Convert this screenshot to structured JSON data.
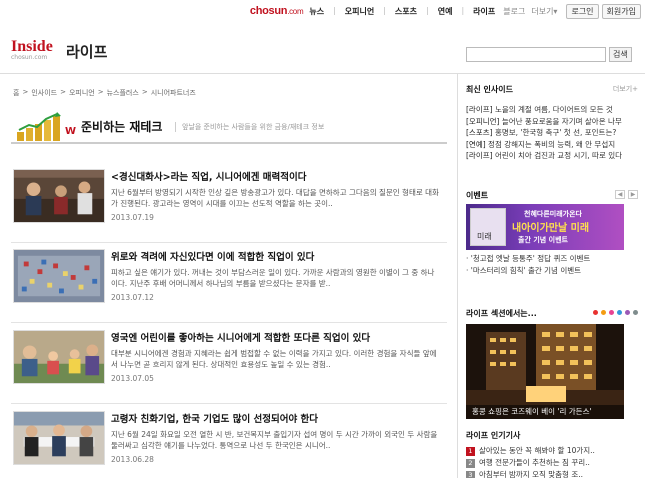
{
  "gnb": {
    "logo": "chosun",
    "logo_suffix": ".com",
    "nav": [
      "뉴스",
      "오피니언",
      "스포츠",
      "연예",
      "라이프"
    ],
    "sub": [
      "블로그",
      "더보기▾"
    ],
    "login": "로그인",
    "join": "회원가입"
  },
  "header": {
    "brand_name": "Inside",
    "brand_site": "chosun.com",
    "section": "라이프",
    "search_placeholder": "",
    "search_button": "검색"
  },
  "breadcrumb": [
    "홈",
    "인사이드",
    "오피니언",
    "뉴스플러스",
    "시니어파트너즈"
  ],
  "banner": {
    "title": "준비하는 재테크",
    "desc": "앞날을 준비하는 사람들을 위한 금융/재테크 정보"
  },
  "articles": [
    {
      "title": "<경신대화사>라는 직업, 시니어에겐 매력적이다",
      "summary": "지난 6월부터 방영되기 시작한 인상 깊은 방송광고가 있다. 대답을 면하하고 그다음의 질문인 형태로 대화가 진행된다. 광고라는 영역이 시대를 이끄는 선도적 역할을 하는 곳이..",
      "date": "2013.07.19"
    },
    {
      "title": "위로와 격려에 자신있다면 이에 적합한 직업이 있다",
      "summary": "피하고 싶은 얘기가 있다. 꺼내는 것이 부담스러운 일이 있다. 가까운 사람과의 영원한 이별이 그 중 하나이다. 지난주 후배 어머니께서 하나님의 부름을 받으셨다는 문자를 받..",
      "date": "2013.07.12"
    },
    {
      "title": "영국엔 어린이를 좋아하는 시니어에게 적합한 또다른 직업이 있다",
      "summary": "대부분 시니어에겐 경험과 지혜라는 쉽게 범접할 수 없는 이력을 가지고 있다. 이러한 경험을 자식들 앞에서 나누면 곧 흐리지 않게 된다. 상대적인 효용성도 높일 수 있는 경험..",
      "date": "2013.07.05"
    },
    {
      "title": "고령자 친화기업, 한국 기업도 많이 선정되어야 한다",
      "summary": "지난 6월 24일 화요일 오전 열한 시 반, 보건복지부 출입기자 섭여 명이 두 시간 가까이 외국인 두 사람을 둘러싸고 심각한 얘기를 나누었다. 통역으로 나선 두 한국인은 시니어..",
      "date": "2013.06.28"
    }
  ],
  "sidebar": {
    "latest_title": "최신 인사이드",
    "latest_more": "더보기+",
    "latest": [
      {
        "tag": "[라이프]",
        "text": " 노을의 계절 여름, 다이어트의 모든 것"
      },
      {
        "tag": "[오피니언]",
        "text": " 늘어난 풍요로움을 자기며 살아온 나무"
      },
      {
        "tag": "[스포츠]",
        "text": " 홍명보, '한국형 축구' 첫 선, 포인트는?"
      },
      {
        "tag": "[연예]",
        "text": " 정점 강해지는 폭비의 능력, 왜 안 무섭지"
      },
      {
        "tag": "[라이프]",
        "text": " 어린이 치아 검진과 교정 시기, 따로 있다"
      }
    ],
    "event_title": "이벤트",
    "event_banner": {
      "line1": "천혜다른미래가온다",
      "line2": "내아이가만날 미래",
      "line3": "출간 기념 이벤트",
      "book_label": "미래"
    },
    "events": [
      "'청고접 엣날 등통주' 정답 퀴즈 이벤트",
      "'마스터리의 힘칙' 출간 기념 이벤트"
    ],
    "photo_title": "라이프 섹션에서는...",
    "photo_caption": "홍콩 쇼핑은 코즈웨이 베이 '리 가든스'",
    "dot_colors": [
      "#e8312f",
      "#f39c12",
      "#e84393",
      "#3498db",
      "#9b59b6",
      "#7f8c8d"
    ],
    "popular_title": "라이프 인기기사",
    "popular": [
      {
        "num": "1",
        "text": "살아있는 동안 꼭 해봐야 할 10가지.."
      },
      {
        "num": "2",
        "text": "여행 전문가들이 추천하는 짐 꾸리.."
      },
      {
        "num": "3",
        "text": "아침부터 밤까지 오직 맞춤형 조.."
      }
    ],
    "accent": "#c1121f"
  }
}
